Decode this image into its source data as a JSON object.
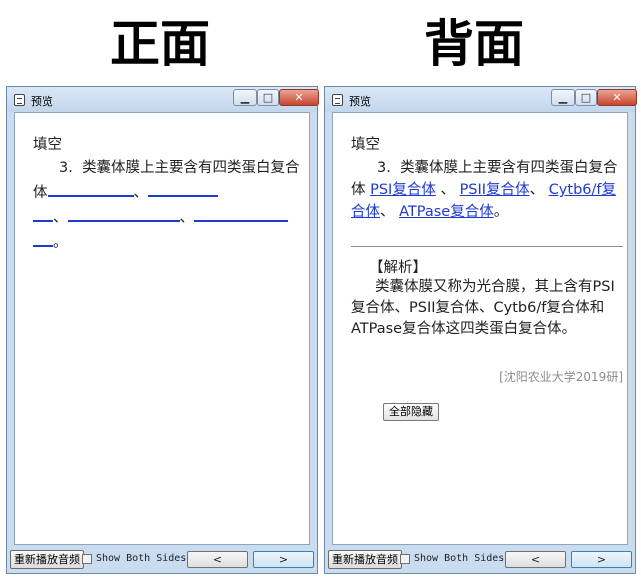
{
  "headings": {
    "front": "正面",
    "back": "背面"
  },
  "window": {
    "title": "预览",
    "min_glyph": "▁",
    "max_glyph": "□",
    "close_glyph": "✕"
  },
  "question": {
    "type": "填空",
    "number": "3.",
    "stem": "类囊体膜上主要含有四类蛋白复合体",
    "sep": "、",
    "end": "。",
    "answers": [
      "PSI复合体",
      "PSII复合体",
      "Cytb6/f复合体",
      "ATPase复合体"
    ]
  },
  "analysis": {
    "heading": "【解析】",
    "text": "类囊体膜又称为光合膜，其上含有PSI复合体、PSII复合体、Cytb6/f复合体和ATPase复合体这四类蛋白复合体。",
    "source": "[沈阳农业大学2019研]",
    "hide_button": "全部隐藏"
  },
  "bottom": {
    "replay": "重新播放音频",
    "show_both": "Show Both Sides",
    "prev": "<",
    "next": ">"
  }
}
